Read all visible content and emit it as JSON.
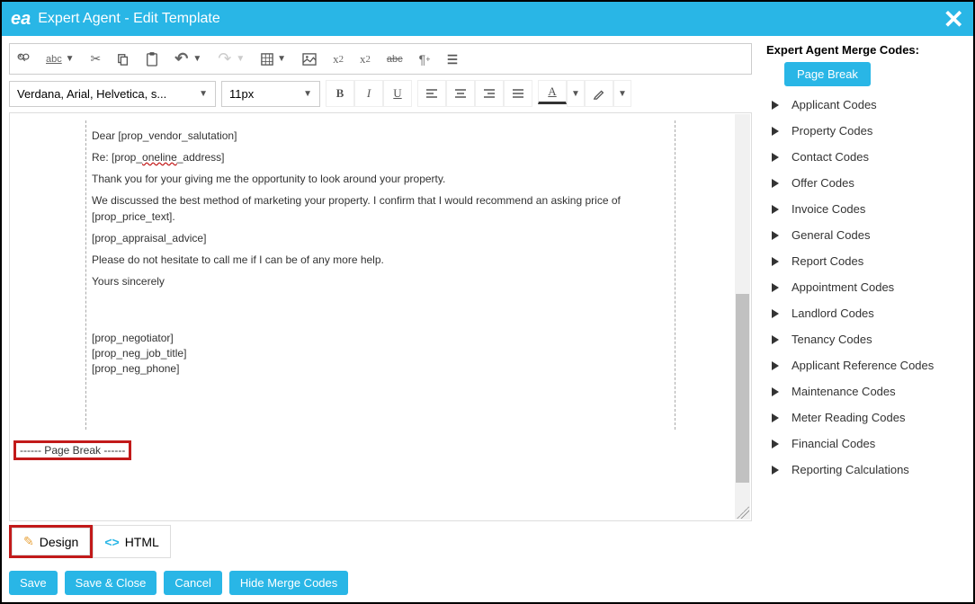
{
  "titlebar": {
    "logo": "ea",
    "title": "Expert Agent - Edit Template"
  },
  "toolbar": {
    "font_family": "Verdana, Arial, Helvetica, s...",
    "font_size": "11px"
  },
  "document": {
    "salutation_prefix": "Dear ",
    "salutation_code": "[prop_vendor_salutation]",
    "re_prefix": "Re: [prop_",
    "re_underlined": "oneline",
    "re_suffix": "_address]",
    "para1": "Thank you for your giving me the opportunity to look around your property.",
    "para2": "We discussed the best method of marketing your property. I confirm that I would recommend an asking price of [prop_price_text].",
    "advice_code": "[prop_appraisal_advice]",
    "para3": "Please do not hesitate to call me if I can be of any more help.",
    "signoff": "Yours sincerely",
    "sig1": "[prop_negotiator]",
    "sig2": "[prop_neg_job_title]",
    "sig3": "[prop_neg_phone]",
    "pagebreak": "------ Page Break ------"
  },
  "tabs": {
    "design": "Design",
    "html": "HTML"
  },
  "buttons": {
    "save": "Save",
    "save_close": "Save & Close",
    "cancel": "Cancel",
    "hide_codes": "Hide Merge Codes"
  },
  "merge": {
    "heading": "Expert Agent Merge Codes:",
    "pagebreak_btn": "Page Break",
    "items": [
      "Applicant Codes",
      "Property Codes",
      "Contact Codes",
      "Offer Codes",
      "Invoice Codes",
      "General Codes",
      "Report Codes",
      "Appointment Codes",
      "Landlord Codes",
      "Tenancy Codes",
      "Applicant Reference Codes",
      "Maintenance Codes",
      "Meter Reading Codes",
      "Financial Codes",
      "Reporting Calculations"
    ]
  }
}
